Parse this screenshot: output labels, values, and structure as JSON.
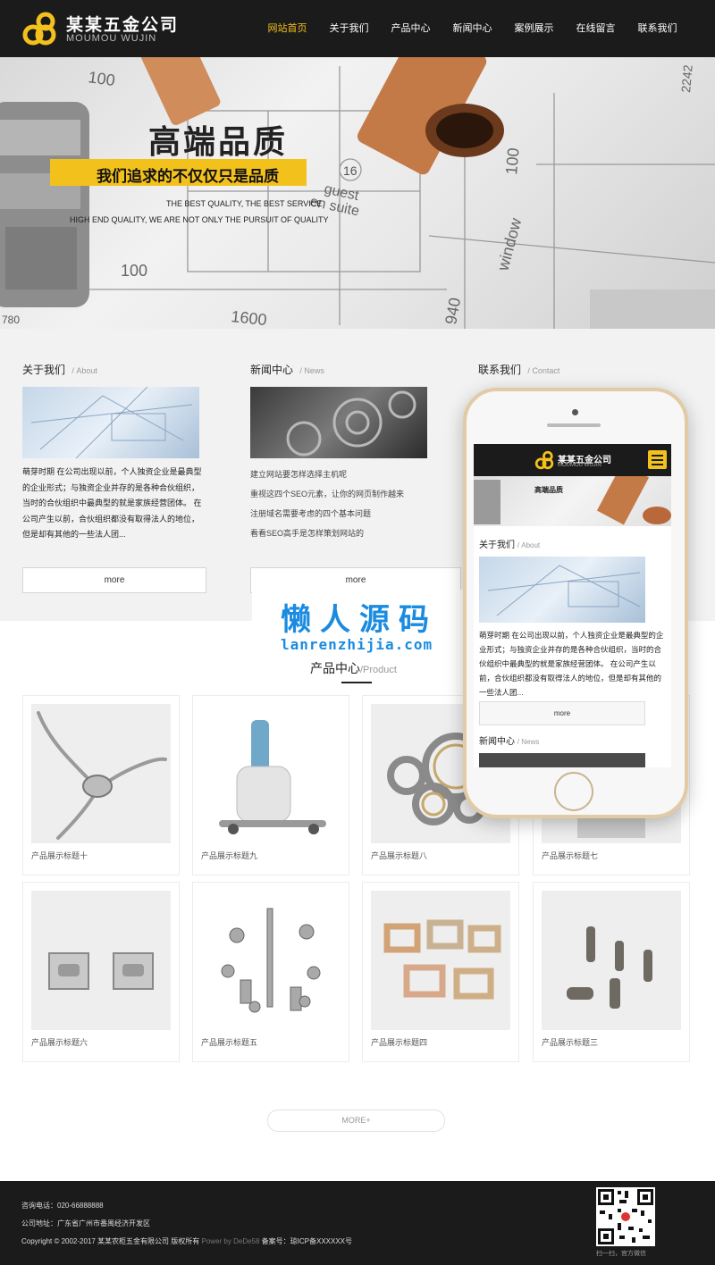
{
  "header": {
    "logo_title": "某某五金公司",
    "logo_sub": "MOUMOU WUJIN",
    "nav": [
      "网站首页",
      "关于我们",
      "产品中心",
      "新闻中心",
      "案例展示",
      "在线留言",
      "联系我们"
    ]
  },
  "hero": {
    "title": "高端品质",
    "subtitle": "我们追求的不仅仅只是品质",
    "en_line1": "THE BEST QUALITY, THE BEST SERVICE",
    "en_line2": "HIGH END QUALITY, WE ARE NOT ONLY THE PURSUIT OF QUALITY",
    "blueprint_labels": [
      "100",
      "100",
      "1600",
      "940",
      "16",
      "guest",
      "en suite",
      "window",
      "100",
      "2242",
      "780"
    ]
  },
  "about": {
    "title": "关于我们",
    "en": "About",
    "text": "萌芽时期 在公司出现以前，个人独资企业是最典型的企业形式；与独资企业并存的是各种合伙组织，当时的合伙组织中最典型的就是家族经营团体。 在公司产生以前，合伙组织都没有取得法人的地位，但是却有其他的一些法人团...",
    "more": "more"
  },
  "news": {
    "title": "新闻中心",
    "en": "News",
    "items": [
      "建立网站要怎样选择主机呢",
      "重视这四个SEO元素，让你的网页制作越来",
      "注册域名需要考虑的四个基本问题",
      "看看SEO高手是怎样策划网站的"
    ],
    "more": "more"
  },
  "contact": {
    "title": "联系我们",
    "en": "Contact"
  },
  "watermark": {
    "line1": "懒人源码",
    "line2": "lanrenzhijia.com"
  },
  "products": {
    "title": "产品中心",
    "en": "/Product",
    "items": [
      {
        "caption": "产品展示标题十",
        "icon": "metal-clamp-icon"
      },
      {
        "caption": "产品展示标题九",
        "icon": "machine-icon"
      },
      {
        "caption": "产品展示标题八",
        "icon": "bearing-icon"
      },
      {
        "caption": "产品展示标题七",
        "icon": "part-icon"
      },
      {
        "caption": "产品展示标题六",
        "icon": "bracket-icon"
      },
      {
        "caption": "产品展示标题五",
        "icon": "screws-icon"
      },
      {
        "caption": "产品展示标题四",
        "icon": "buckle-icon"
      },
      {
        "caption": "产品展示标题三",
        "icon": "rivet-icon"
      }
    ],
    "more": "MORE+"
  },
  "footer": {
    "phone": "咨询电话：020-66888888",
    "address": "公司地址：广东省广州市番禺经济开发区",
    "copyright_prefix": "Copyright © 2002-2017 某某农柜五金有限公司 版权所有",
    "powered": "Power by DeDe58",
    "icp": "备案号：琼ICP备XXXXXX号",
    "qr_caption": "扫一扫，官方微信"
  },
  "phone_preview": {
    "logo_title": "某某五金公司",
    "logo_sub": "MOUMOU WUJIN",
    "banner_text": "高端品质",
    "about_title": "关于我们",
    "about_en": "About",
    "about_text": "萌芽时期 在公司出现以前，个人独资企业是最典型的企业形式；与独资企业并存的是各种合伙组织，当时的合伙组织中最典型的就是家族经营团体。 在公司产生以前，合伙组织都没有取得法人的地位，但是却有其他的一些法人团...",
    "more": "more",
    "news_title": "新闻中心",
    "news_en": "News"
  },
  "colors": {
    "accent": "#f3c11c",
    "dark": "#1b1b1b"
  }
}
